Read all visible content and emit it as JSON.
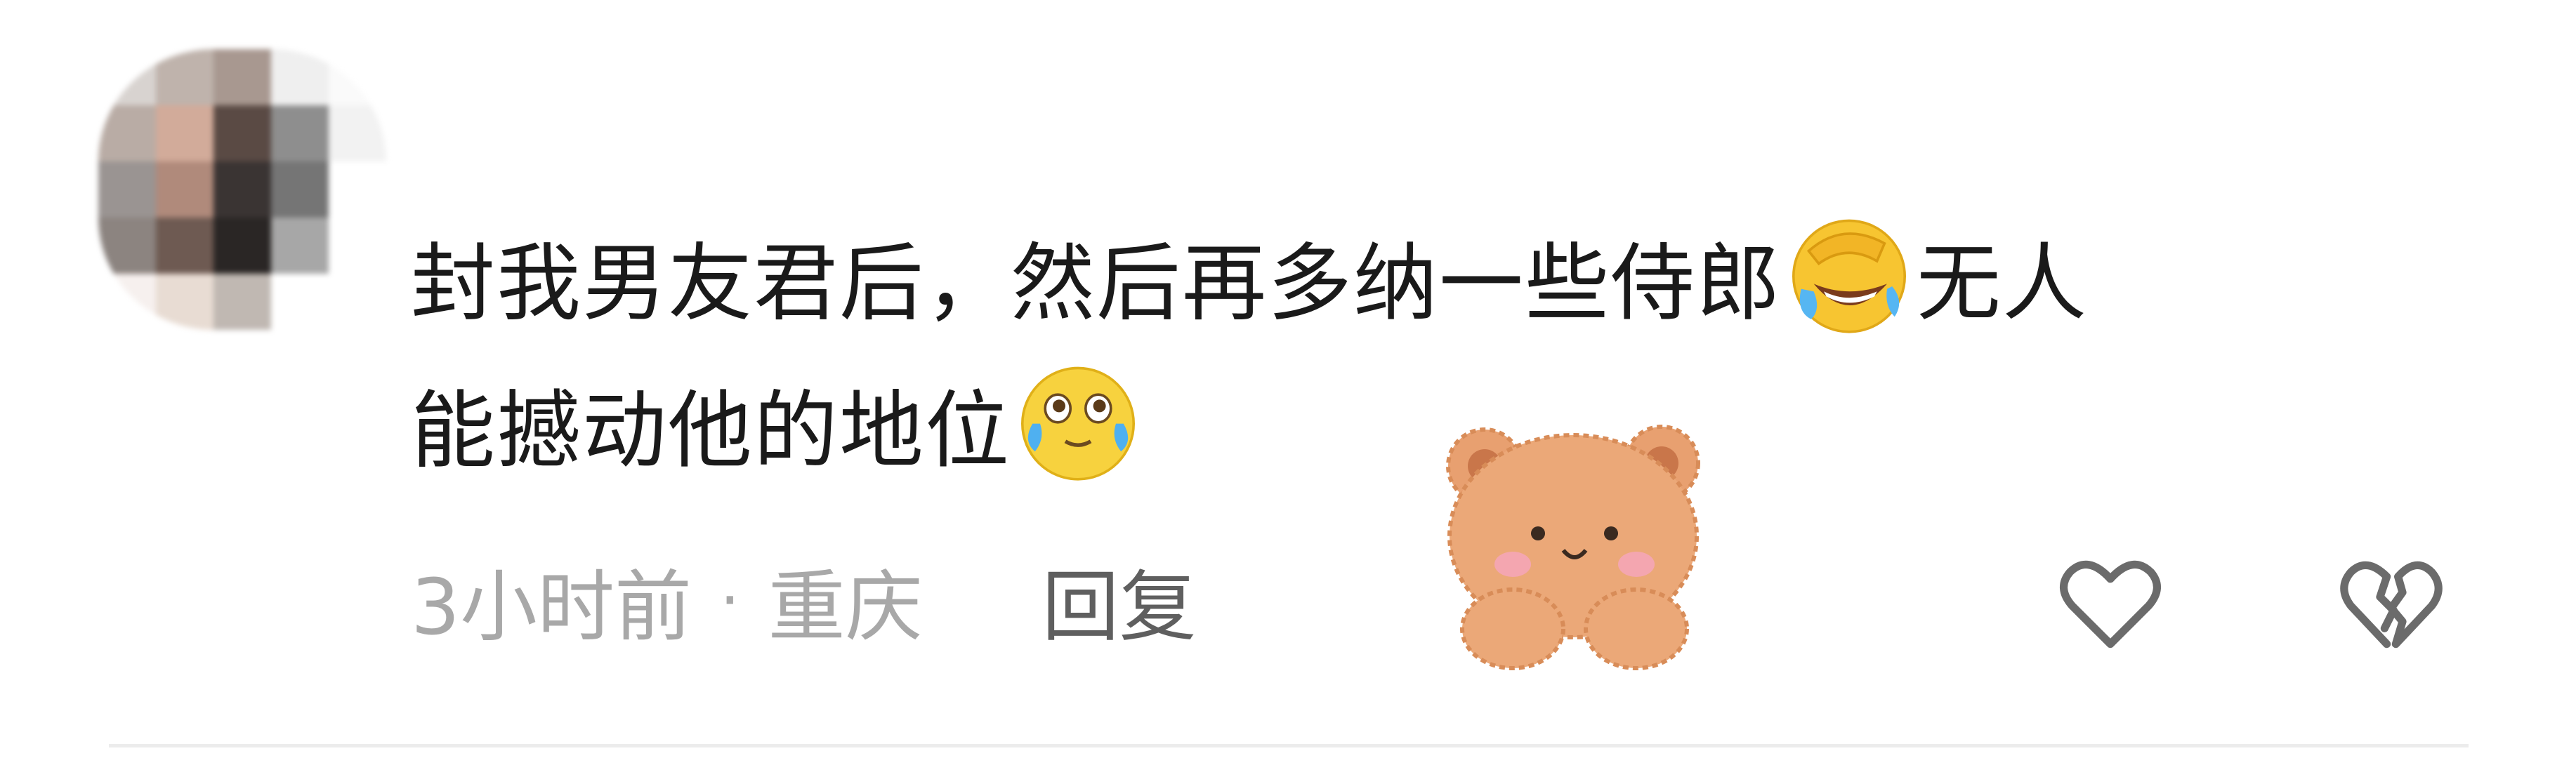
{
  "comment": {
    "text_line1": "封我男友君后，然后再多纳一些侍郎",
    "text_line1_end": "无人",
    "text_line2": "能撼动他的地位",
    "emoji_1": "face-with-hand-laughing-emoji",
    "emoji_2": "pleading-crying-emoji",
    "time": "3小时前",
    "separator": "·",
    "location": "重庆",
    "reply_label": "回复",
    "sticker": "bear-sticker"
  },
  "actions": {
    "like_icon": "heart-outline-icon",
    "dislike_icon": "broken-heart-icon"
  },
  "colors": {
    "text": "#1a1a1a",
    "meta": "#a8a8a8",
    "reply": "#5f5f5f",
    "icon": "#6b6b6b",
    "emoji_yellow": "#f7c531",
    "bear": "#e8a070"
  }
}
